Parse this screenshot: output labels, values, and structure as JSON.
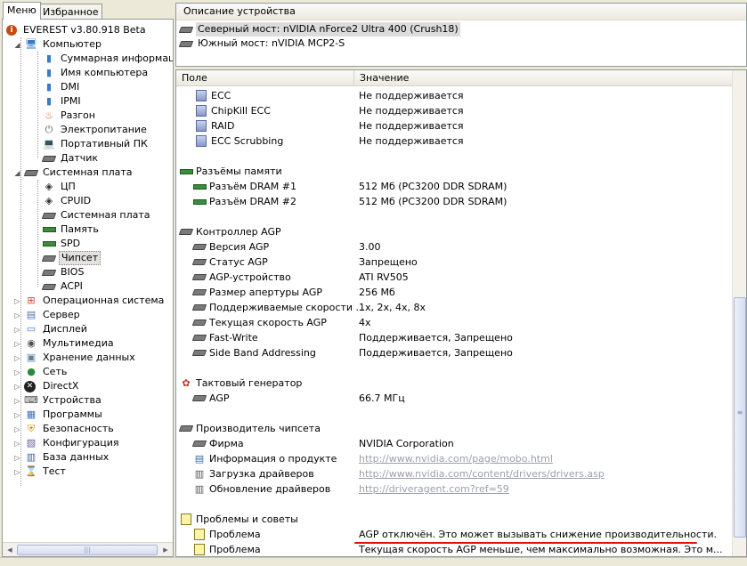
{
  "tabs": [
    {
      "label": "Меню"
    },
    {
      "label": "Избранное"
    }
  ],
  "tree": [
    {
      "label": "EVEREST v3.80.918 Beta",
      "icon": "info-icon"
    },
    {
      "label": "Компьютер",
      "icon": "computer-icon"
    },
    {
      "label": "Суммарная информация",
      "icon": "info-icon"
    },
    {
      "label": "Имя компьютера",
      "icon": "computer-icon"
    },
    {
      "label": "DMI",
      "icon": "computer-icon"
    },
    {
      "label": "IPMI",
      "icon": "computer-icon"
    },
    {
      "label": "Разгон",
      "icon": "flame-icon"
    },
    {
      "label": "Электропитание",
      "icon": "power-icon"
    },
    {
      "label": "Портативный ПК",
      "icon": "laptop-icon"
    },
    {
      "label": "Датчик",
      "icon": "sensor-icon"
    },
    {
      "label": "Системная плата",
      "icon": "motherboard-icon"
    },
    {
      "label": "ЦП",
      "icon": "cpu-icon"
    },
    {
      "label": "CPUID",
      "icon": "cpu-icon"
    },
    {
      "label": "Системная плата",
      "icon": "motherboard-icon"
    },
    {
      "label": "Память",
      "icon": "ram-icon"
    },
    {
      "label": "SPD",
      "icon": "ram-icon"
    },
    {
      "label": "Чипсет",
      "icon": "chip-icon"
    },
    {
      "label": "BIOS",
      "icon": "chip-icon"
    },
    {
      "label": "ACPI",
      "icon": "chip-icon"
    },
    {
      "label": "Операционная система",
      "icon": "windows-icon"
    },
    {
      "label": "Сервер",
      "icon": "server-icon"
    },
    {
      "label": "Дисплей",
      "icon": "monitor-icon"
    },
    {
      "label": "Мультимедиа",
      "icon": "speaker-icon"
    },
    {
      "label": "Хранение данных",
      "icon": "disk-icon"
    },
    {
      "label": "Сеть",
      "icon": "network-icon"
    },
    {
      "label": "DirectX",
      "icon": "directx-icon"
    },
    {
      "label": "Устройства",
      "icon": "devices-icon"
    },
    {
      "label": "Программы",
      "icon": "programs-icon"
    },
    {
      "label": "Безопасность",
      "icon": "shield-icon"
    },
    {
      "label": "Конфигурация",
      "icon": "config-icon"
    },
    {
      "label": "База данных",
      "icon": "database-icon"
    },
    {
      "label": "Тест",
      "icon": "hourglass-icon"
    }
  ],
  "device_panel": {
    "header": "Описание устройства",
    "items": [
      {
        "label": "Северный мост: nVIDIA nForce2 Ultra 400 (Crush18)"
      },
      {
        "label": "Южный мост: nVIDIA MCP2-S"
      }
    ]
  },
  "list": {
    "columns": {
      "field": "Поле",
      "value": "Значение"
    },
    "rows": [
      {
        "field": "ECC",
        "value": "Не поддерживается",
        "icon": "cube-icon"
      },
      {
        "field": "ChipKill ECC",
        "value": "Не поддерживается",
        "icon": "cube-icon"
      },
      {
        "field": "RAID",
        "value": "Не поддерживается",
        "icon": "cube-icon"
      },
      {
        "field": "ECC Scrubbing",
        "value": "Не поддерживается",
        "icon": "cube-icon"
      },
      {
        "field": "Разъёмы памяти",
        "value": "",
        "icon": "ram-icon"
      },
      {
        "field": "Разъём DRAM #1",
        "value": "512 Мб  (PC3200 DDR SDRAM)",
        "icon": "ram-icon"
      },
      {
        "field": "Разъём DRAM #2",
        "value": "512 Мб  (PC3200 DDR SDRAM)",
        "icon": "ram-icon"
      },
      {
        "field": "Контроллер AGP",
        "value": "",
        "icon": "chip-icon"
      },
      {
        "field": "Версия AGP",
        "value": "3.00",
        "icon": "chip-icon"
      },
      {
        "field": "Статус AGP",
        "value": "Запрещено",
        "icon": "chip-icon"
      },
      {
        "field": "AGP-устройство",
        "value": "ATI RV505",
        "icon": "chip-icon"
      },
      {
        "field": "Размер апертуры AGP",
        "value": "256 Мб",
        "icon": "chip-icon"
      },
      {
        "field": "Поддерживаемые скорости ...",
        "value": "1x, 2x, 4x, 8x",
        "icon": "chip-icon"
      },
      {
        "field": "Текущая скорость AGP",
        "value": "4x",
        "icon": "chip-icon"
      },
      {
        "field": "Fast-Write",
        "value": "Поддерживается, Запрещено",
        "icon": "chip-icon"
      },
      {
        "field": "Side Band Addressing",
        "value": "Поддерживается, Запрещено",
        "icon": "chip-icon"
      },
      {
        "field": "Тактовый генератор",
        "value": "",
        "icon": "clock-icon"
      },
      {
        "field": "AGP",
        "value": "66.7 МГц",
        "icon": "chip-icon"
      },
      {
        "field": "Производитель чипсета",
        "value": "",
        "icon": "chip-icon"
      },
      {
        "field": "Фирма",
        "value": "NVIDIA Corporation",
        "icon": "chip-icon"
      },
      {
        "field": "Информация о продукте",
        "value": "http://www.nvidia.com/page/mobo.html",
        "icon": "info-doc-icon"
      },
      {
        "field": "Загрузка драйверов",
        "value": "http://www.nvidia.com/content/drivers/drivers.asp",
        "icon": "driver-icon"
      },
      {
        "field": "Обновление драйверов",
        "value": "http://driveragent.com?ref=59",
        "icon": "driver-icon"
      },
      {
        "field": "Проблемы и советы",
        "value": "",
        "icon": "note-icon"
      },
      {
        "field": "Проблема",
        "value": "AGP отключён. Это может вызывать снижение производительности.",
        "icon": "note-icon"
      },
      {
        "field": "Проблема",
        "value": "Текущая скорость AGP меньше, чем максимально возможная. Это м...",
        "icon": "note-icon"
      }
    ]
  },
  "colors": {
    "accent_red": "#e01010",
    "link": "#9aa0a8",
    "selection": "#dcdcdc"
  }
}
